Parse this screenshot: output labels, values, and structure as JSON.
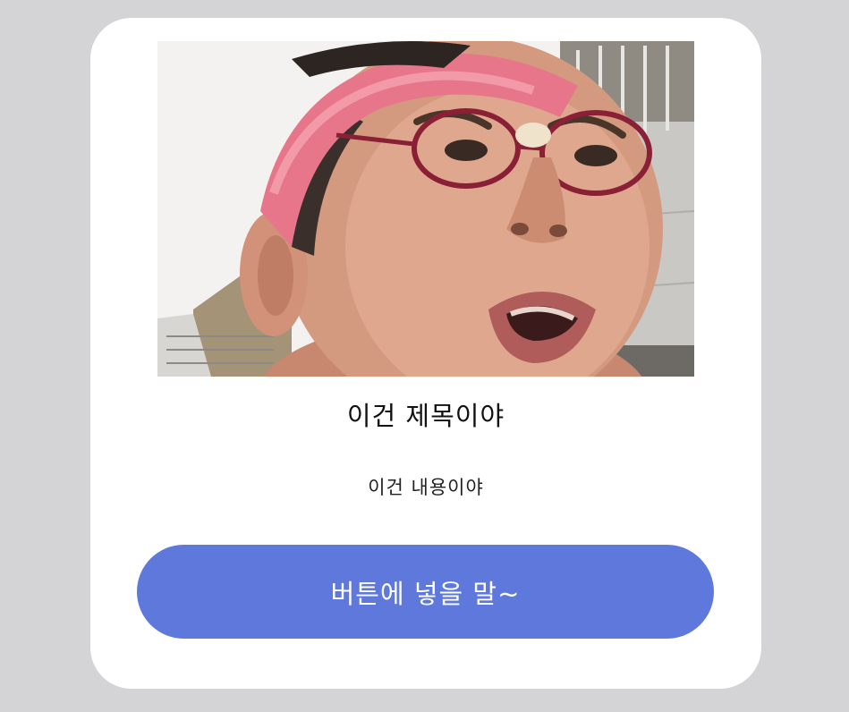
{
  "card": {
    "title": "이건 제목이야",
    "content": "이건 내용이야",
    "button_label": "버튼에 넣을 말~"
  },
  "colors": {
    "page_background": "#d4d4d6",
    "card_background": "#ffffff",
    "button_background": "#5e79db",
    "button_text": "#ffffff"
  }
}
